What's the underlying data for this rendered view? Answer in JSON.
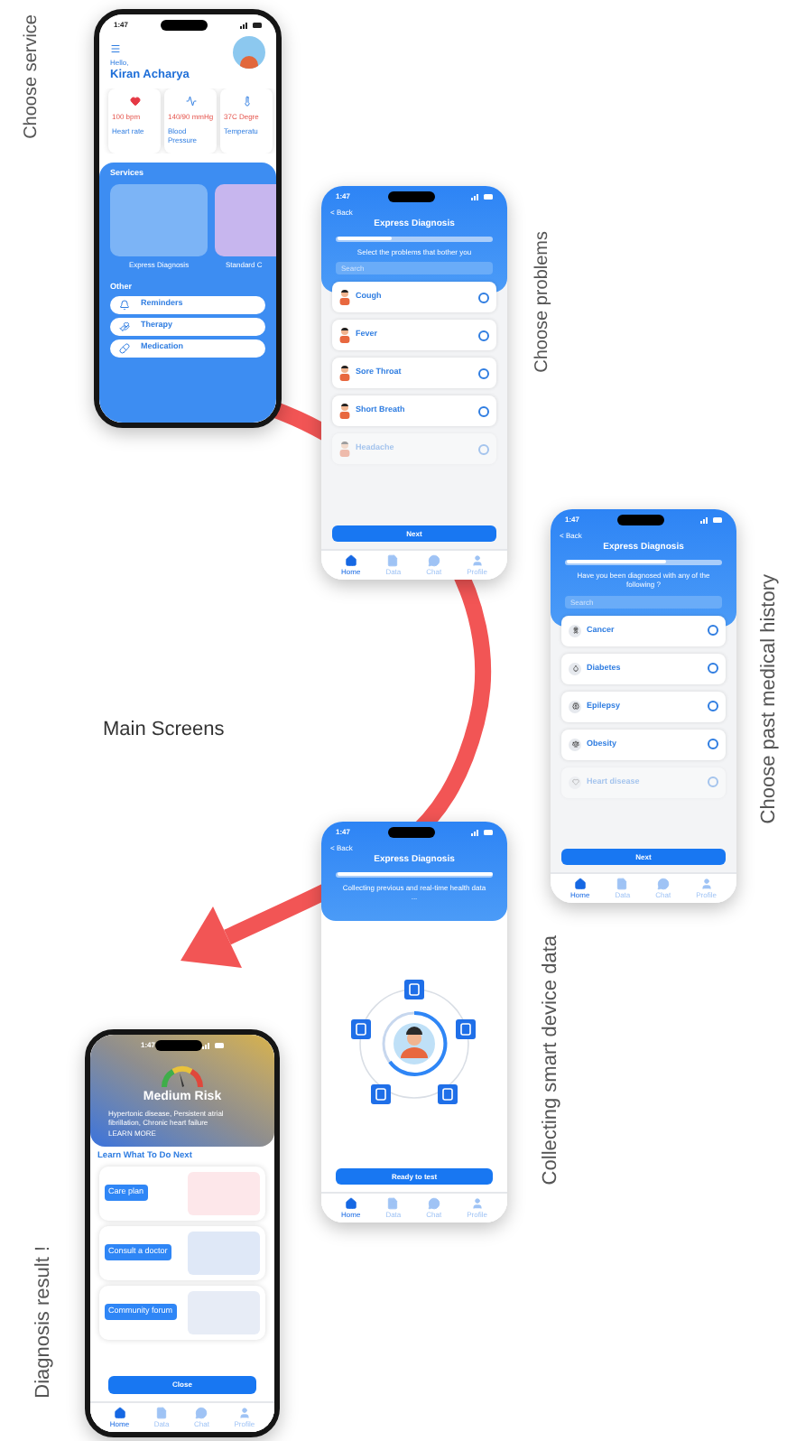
{
  "heading": "Main Screens",
  "screens": [
    {
      "kind": "home",
      "caption": "Choose service",
      "status_time": "1:47",
      "greeting": "Hello,",
      "user_name": "Kiran Acharya",
      "vitals": [
        {
          "value": "100 bpm",
          "label": "Heart rate"
        },
        {
          "value": "140/90 mmHg",
          "label": "Blood Pressure"
        },
        {
          "value": "37C Degre",
          "label": "Temperatu"
        }
      ],
      "services_title": "Services",
      "services": [
        {
          "label": "Express Diagnosis"
        },
        {
          "label": "Standard C"
        }
      ],
      "other_title": "Other",
      "other": [
        {
          "label": "Reminders"
        },
        {
          "label": "Therapy"
        },
        {
          "label": "Medication"
        }
      ]
    },
    {
      "kind": "checklist",
      "caption": "Choose problems",
      "status_time": "1:47",
      "back": "< Back",
      "title": "Express Diagnosis",
      "progress": {
        "level": 0.35
      },
      "prompt": "Select the problems that bother you",
      "search": {
        "placeholder": "Search"
      },
      "options": [
        {
          "label": "Cough",
          "checked": false,
          "faded": false
        },
        {
          "label": "Fever",
          "checked": false,
          "faded": false
        },
        {
          "label": "Sore Throat",
          "checked": false,
          "faded": false
        },
        {
          "label": "Short Breath",
          "checked": false,
          "faded": false
        },
        {
          "label": "Headache",
          "checked": false,
          "faded": true
        }
      ],
      "button": "Next",
      "nav": [
        {
          "label": "Home",
          "selected": true
        },
        {
          "label": "Data",
          "selected": false
        },
        {
          "label": "Chat",
          "selected": false
        },
        {
          "label": "Profile",
          "selected": false
        }
      ]
    },
    {
      "kind": "checklist",
      "caption": "Choose past medical history",
      "status_time": "1:47",
      "back": "< Back",
      "title": "Express Diagnosis",
      "progress": {
        "level": 0.65
      },
      "prompt": "Have you been diagnosed with any of the following ?",
      "search": {
        "placeholder": "Search"
      },
      "options": [
        {
          "label": "Cancer",
          "checked": false,
          "faded": false
        },
        {
          "label": "Diabetes",
          "checked": false,
          "faded": false
        },
        {
          "label": "Epilepsy",
          "checked": false,
          "faded": false
        },
        {
          "label": "Obesity",
          "checked": false,
          "faded": false
        },
        {
          "label": "Heart disease",
          "checked": false,
          "faded": true
        }
      ],
      "button": "Next",
      "nav": [
        {
          "label": "Home",
          "selected": true
        },
        {
          "label": "Data",
          "selected": false
        },
        {
          "label": "Chat",
          "selected": false
        },
        {
          "label": "Profile",
          "selected": false
        }
      ]
    },
    {
      "kind": "collecting",
      "caption": "Collecting smart device data",
      "status_time": "1:47",
      "back": "< Back",
      "title": "Express Diagnosis",
      "progress": {
        "level": 1
      },
      "prompt": "Collecting previous and real-time health data ...",
      "button": "Ready to test",
      "nav": [
        {
          "label": "Home",
          "selected": true
        },
        {
          "label": "Data",
          "selected": false
        },
        {
          "label": "Chat",
          "selected": false
        },
        {
          "label": "Profile",
          "selected": false
        }
      ]
    },
    {
      "kind": "result",
      "caption": "Diagnosis result !",
      "status_time": "1:47",
      "risk": "Medium Risk",
      "description": "Hypertonic disease, Persistent atrial fibrillation, Chronic heart failure",
      "learn_more": "LEARN MORE",
      "section_title": "Learn What To Do Next",
      "cards": [
        {
          "label": "Care plan"
        },
        {
          "label": "Consult a doctor"
        },
        {
          "label": "Community forum"
        }
      ],
      "button": "Close",
      "nav": [
        {
          "label": "Home",
          "selected": true
        },
        {
          "label": "Data",
          "selected": false
        },
        {
          "label": "Chat",
          "selected": false
        },
        {
          "label": "Profile",
          "selected": false
        }
      ]
    }
  ]
}
